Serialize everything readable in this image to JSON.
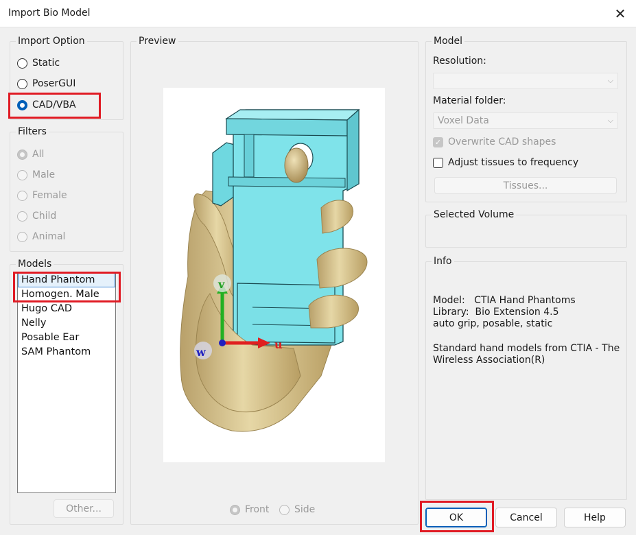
{
  "window": {
    "title": "Import Bio Model",
    "close_glyph": "✕"
  },
  "import_option": {
    "title": "Import Option",
    "options": [
      {
        "label": "Static",
        "checked": false
      },
      {
        "label": "PoserGUI",
        "checked": false
      },
      {
        "label": "CAD/VBA",
        "checked": true
      }
    ]
  },
  "filters": {
    "title": "Filters",
    "options": [
      {
        "label": "All",
        "checked": true
      },
      {
        "label": "Male",
        "checked": false
      },
      {
        "label": "Female",
        "checked": false
      },
      {
        "label": "Child",
        "checked": false
      },
      {
        "label": "Animal",
        "checked": false
      }
    ]
  },
  "models": {
    "title": "Models",
    "items": [
      "Hand Phantom",
      "Homogen. Male",
      "Hugo CAD",
      "Nelly",
      "Posable Ear",
      "SAM Phantom"
    ],
    "selected_index": 0,
    "other_button": "Other..."
  },
  "preview": {
    "title": "Preview",
    "axis_labels": {
      "v": "v",
      "u": "u",
      "w": "w"
    },
    "views": [
      {
        "label": "Front",
        "checked": true
      },
      {
        "label": "Side",
        "checked": false
      }
    ],
    "colors": {
      "phone": "#7fe3ea",
      "hand": "#d9c58e",
      "axis_u": "#e02020",
      "axis_v": "#22b022",
      "axis_w": "#2020c0"
    }
  },
  "model": {
    "title": "Model",
    "resolution_label": "Resolution:",
    "resolution_value": "",
    "material_folder_label": "Material folder:",
    "material_folder_value": "Voxel Data",
    "overwrite_label": "Overwrite CAD shapes",
    "overwrite_checked": true,
    "adjust_label": "Adjust tissues to frequency",
    "adjust_checked": false,
    "tissues_button": "Tissues..."
  },
  "selected_volume": {
    "title": "Selected Volume"
  },
  "info": {
    "title": "Info",
    "lines": [
      "Model:   CTIA Hand Phantoms",
      "Library:  Bio Extension 4.5",
      "auto grip, posable, static",
      "",
      "Standard hand models from CTIA - The",
      "Wireless Association(R)"
    ]
  },
  "buttons": {
    "ok": "OK",
    "cancel": "Cancel",
    "help": "Help"
  },
  "accent_color": "#005fb8",
  "highlight_color": "#e01b24"
}
